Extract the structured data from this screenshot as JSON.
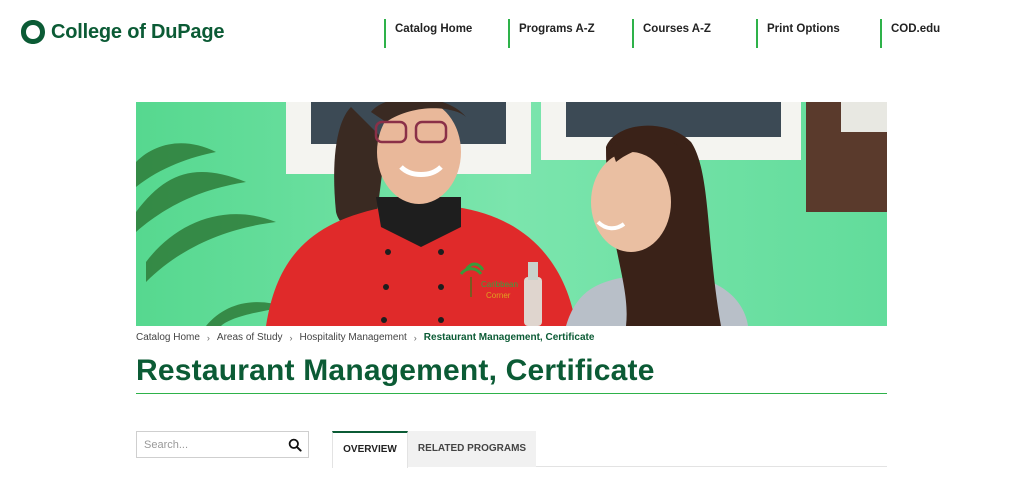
{
  "header": {
    "logo_text": "College of DuPage",
    "nav": [
      {
        "label": "Catalog Home"
      },
      {
        "label": "Programs A-Z"
      },
      {
        "label": "Courses A-Z"
      },
      {
        "label": "Print Options"
      },
      {
        "label": "COD.edu"
      }
    ]
  },
  "hero": {
    "logo_text_line1": "Caribbean",
    "logo_text_line2": "Corner"
  },
  "breadcrumb": {
    "items": [
      "Catalog Home",
      "Areas of Study",
      "Hospitality Management"
    ],
    "current": "Restaurant Management, Certificate",
    "separator": "›"
  },
  "page": {
    "title": "Restaurant Management, Certificate"
  },
  "search": {
    "placeholder": "Search...",
    "value": ""
  },
  "tabs": [
    {
      "label": "OVERVIEW",
      "active": true
    },
    {
      "label": "RELATED PROGRAMS",
      "active": false
    }
  ],
  "colors": {
    "brand_green": "#0b5b35",
    "accent_green": "#2eb24a"
  }
}
